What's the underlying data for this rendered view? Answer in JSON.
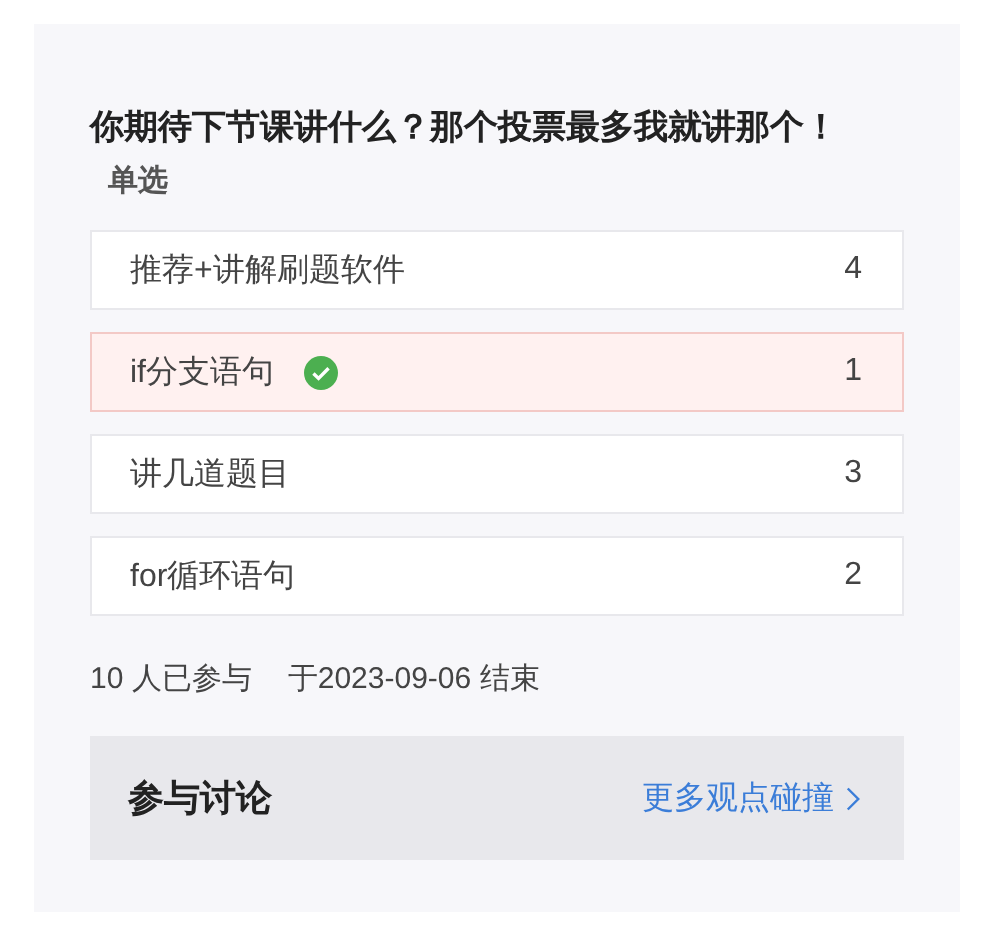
{
  "poll": {
    "title": "你期待下节课讲什么？那个投票最多我就讲那个！",
    "type_label": "单选",
    "options": [
      {
        "label": "推荐+讲解刷题软件",
        "count": "4",
        "selected": false
      },
      {
        "label": "if分支语句",
        "count": "1",
        "selected": true
      },
      {
        "label": "讲几道题目",
        "count": "3",
        "selected": false
      },
      {
        "label": "for循环语句",
        "count": "2",
        "selected": false
      }
    ],
    "participants": "10 人已参与",
    "deadline": "于2023-09-06 结束"
  },
  "discussion": {
    "title": "参与讨论",
    "link": "更多观点碰撞"
  }
}
